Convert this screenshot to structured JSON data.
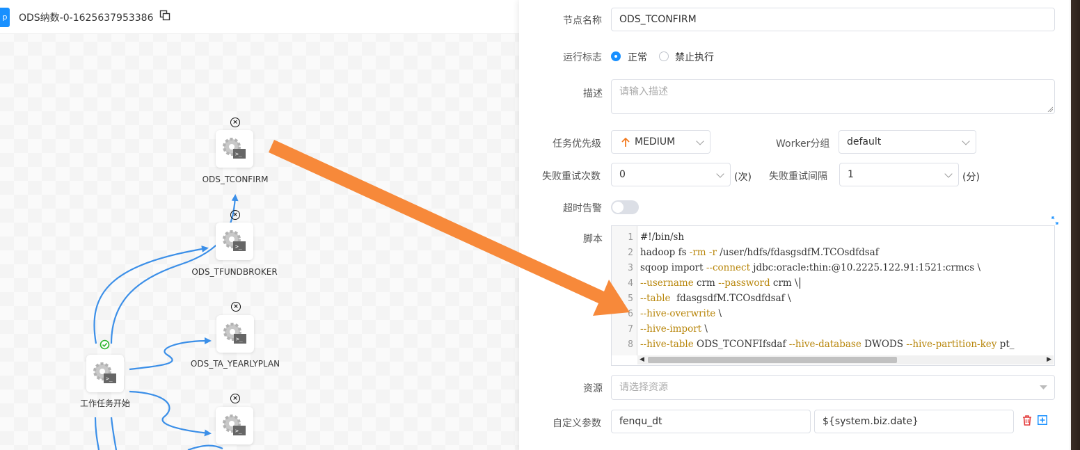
{
  "workflow": {
    "nav_tab_label": "p",
    "title": "ODS纳数-0-1625637953386"
  },
  "nodes": [
    {
      "id": "tconfirm",
      "label": "ODS_TCONFIRM"
    },
    {
      "id": "tfundbroker",
      "label": "ODS_TFUNDBROKER"
    },
    {
      "id": "yearlyplan",
      "label": "ODS_TA_YEARLYPLAN"
    },
    {
      "id": "start",
      "label": "工作任务开始"
    },
    {
      "id": "unnamed",
      "label": ""
    }
  ],
  "form": {
    "node_name_label": "节点名称",
    "node_name_value": "ODS_TCONFIRM",
    "run_flag_label": "运行标志",
    "run_flag_normal": "正常",
    "run_flag_forbid": "禁止执行",
    "desc_label": "描述",
    "desc_placeholder": "请输入描述",
    "priority_label": "任务优先级",
    "priority_value": "MEDIUM",
    "worker_group_label": "Worker分组",
    "worker_group_value": "default",
    "retry_times_label": "失败重试次数",
    "retry_times_value": "0",
    "retry_times_unit": "(次)",
    "retry_interval_label": "失败重试间隔",
    "retry_interval_value": "1",
    "retry_interval_unit": "(分)",
    "timeout_alarm_label": "超时告警",
    "script_label": "脚本",
    "resource_label": "资源",
    "resource_placeholder": "请选择资源",
    "custom_params_label": "自定义参数",
    "custom_param_key": "fenqu_dt",
    "custom_param_value": "${system.biz.date}"
  },
  "script_lines": [
    {
      "n": "1",
      "parts": [
        [
          "",
          "#!/bin/sh"
        ]
      ]
    },
    {
      "n": "2",
      "parts": [
        [
          "",
          "hadoop fs "
        ],
        [
          "kw",
          "-rm -r"
        ],
        [
          "",
          " /user/hdfs/fdasgsdfM.TCOsdfdsaf"
        ]
      ]
    },
    {
      "n": "3",
      "parts": [
        [
          "",
          "sqoop import "
        ],
        [
          "kw",
          "--connect"
        ],
        [
          "",
          " jdbc:oracle:thin:@10.2225.122.91:1521:crmcs \\"
        ]
      ]
    },
    {
      "n": "4",
      "parts": [
        [
          "kw",
          "--username"
        ],
        [
          "",
          " crm "
        ],
        [
          "kw",
          "--password"
        ],
        [
          "",
          " crm \\"
        ]
      ]
    },
    {
      "n": "5",
      "parts": [
        [
          "kw",
          "--table"
        ],
        [
          "",
          "  fdasgsdfM.TCOsdfdsaf \\"
        ]
      ]
    },
    {
      "n": "6",
      "parts": [
        [
          "kw",
          "--hive-overwrite"
        ],
        [
          "",
          " \\"
        ]
      ]
    },
    {
      "n": "7",
      "parts": [
        [
          "kw",
          "--hive-import"
        ],
        [
          "",
          " \\"
        ]
      ]
    },
    {
      "n": "8",
      "parts": [
        [
          "kw",
          "--hive-table"
        ],
        [
          "",
          " ODS_TCONFIfsdaf "
        ],
        [
          "kw",
          "--hive-database"
        ],
        [
          "",
          " DWODS "
        ],
        [
          "kw",
          "--hive-partition-key"
        ],
        [
          "",
          " pt_"
        ]
      ]
    }
  ],
  "colors": {
    "accent": "#1890ff",
    "edge": "#3b8fe8",
    "annotation_arrow": "#f7893a",
    "priority_arrow": "#f27a1f",
    "delete": "#e33b3b"
  },
  "icons": [
    "copy-icon",
    "shell-task-icon",
    "close-circle-icon",
    "check-circle-icon",
    "arrow-up-icon",
    "chevron-down-icon",
    "expand-icon",
    "delete-icon",
    "add-icon"
  ]
}
